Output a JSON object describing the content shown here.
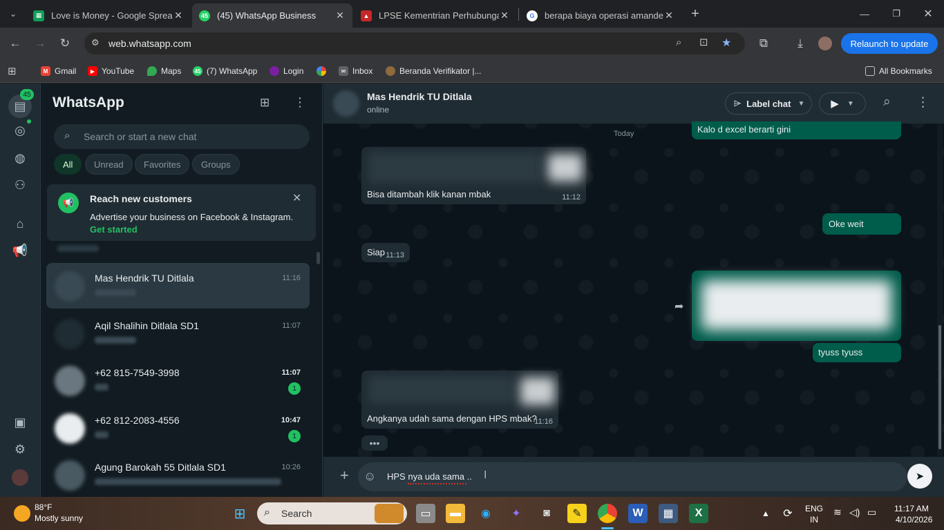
{
  "tabs": [
    {
      "title": "Love is Money - Google Spread",
      "favicon": "sheets-icon",
      "color": "#0f9d58"
    },
    {
      "title": "(45) WhatsApp Business",
      "favicon": "whatsapp-icon",
      "color": "#25d366",
      "badge": "45"
    },
    {
      "title": "LPSE Kementrian Perhubungan",
      "favicon": "lpse-icon",
      "color": "#c62828"
    },
    {
      "title": "berapa biaya operasi amandel",
      "favicon": "google-icon",
      "color": "#ffffff"
    }
  ],
  "address": {
    "url": "web.whatsapp.com"
  },
  "relaunch_label": "Relaunch to update",
  "bookmarks": [
    {
      "label": "Gmail",
      "color": "#ea4335"
    },
    {
      "label": "YouTube",
      "color": "#ff0000"
    },
    {
      "label": "Maps",
      "color": "#34a853"
    },
    {
      "label": "(7) WhatsApp",
      "color": "#25d366",
      "badge": "45"
    },
    {
      "label": "Login",
      "color": "#7b1fa2"
    },
    {
      "label": "Inbox",
      "color": "#9aa0a6"
    },
    {
      "label": "Beranda Verifikator |...",
      "color": "#8e6a3d"
    }
  ],
  "all_bookmarks": "All Bookmarks",
  "rail": {
    "chats_badge": "45"
  },
  "sidebar": {
    "title": "WhatsApp",
    "search_placeholder": "Search or start a new chat",
    "filters": [
      "All",
      "Unread",
      "Favorites",
      "Groups"
    ],
    "promo": {
      "title": "Reach new customers",
      "body": "Advertise your business on Facebook & Instagram.",
      "cta": "Get started"
    },
    "chats": [
      {
        "name": "Mas Hendrik TU Ditlala",
        "time": "11:16"
      },
      {
        "name": "Aqil Shalihin Ditlala SD1",
        "time": "11:07"
      },
      {
        "name": "+62 815-7549-3998",
        "time": "11:07",
        "unread": "1"
      },
      {
        "name": "+62 812-2083-4556",
        "time": "10:47",
        "unread": "1"
      },
      {
        "name": "Agung Barokah 55 Ditlala SD1",
        "time": "10:26"
      }
    ]
  },
  "conversation": {
    "contact": "Mas Hendrik TU Ditlala",
    "status": "online",
    "label_chat": "Label chat",
    "date_chip": "Today",
    "messages": [
      {
        "text": "Kalo d excel berarti gini",
        "dir": "out"
      },
      {
        "text": "Bisa ditambah klik kanan mbak",
        "time": "11:12",
        "dir": "in"
      },
      {
        "text": "Oke weit",
        "dir": "out"
      },
      {
        "text": "Siap",
        "time": "11:13",
        "dir": "in"
      },
      {
        "text": "tyuss tyuss",
        "dir": "out"
      },
      {
        "text": "Angkanya udah sama dengan HPS mbak?",
        "time": "11:16",
        "dir": "in"
      }
    ],
    "composer_text": "HPS nya uda sama .."
  },
  "taskbar": {
    "weather_temp": "88°F",
    "weather_desc": "Mostly sunny",
    "search": "Search",
    "lang": "ENG",
    "region": "IN",
    "time": "11:17 AM",
    "date": "4/10/2026"
  }
}
